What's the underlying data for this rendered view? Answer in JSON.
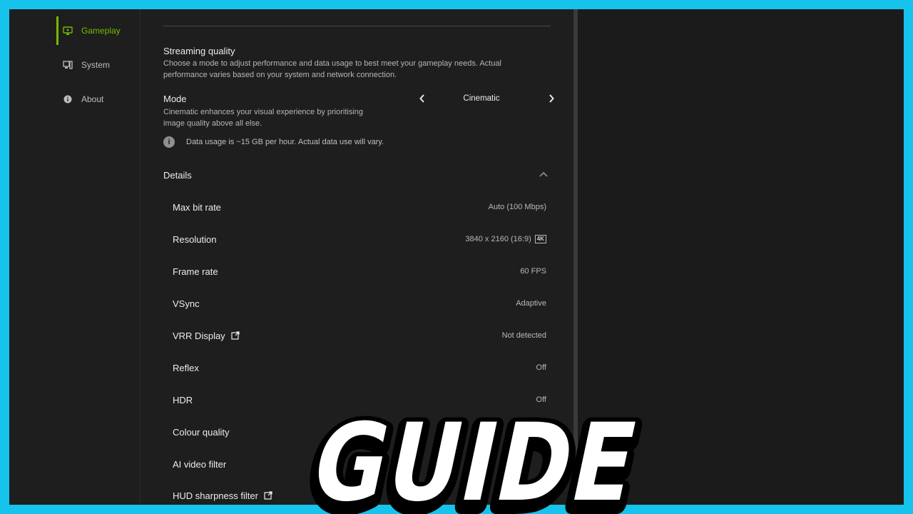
{
  "sidebar": {
    "items": [
      {
        "label": "Gameplay",
        "icon": "monitor-gamepad-icon",
        "active": true
      },
      {
        "label": "System",
        "icon": "system-devices-icon",
        "active": false
      },
      {
        "label": "About",
        "icon": "info-icon",
        "active": false
      }
    ]
  },
  "streaming": {
    "title": "Streaming quality",
    "description_line1": "Choose a mode to adjust performance and data usage to best meet your gameplay needs. Actual",
    "description_line2": "performance varies based on your system and network connection."
  },
  "mode": {
    "title": "Mode",
    "description_line1": "Cinematic enhances your visual experience by prioritising",
    "description_line2": "image quality above all else.",
    "value": "Cinematic",
    "info": "Data usage is ~15 GB per hour. Actual data use will vary."
  },
  "details": {
    "title": "Details",
    "rows": [
      {
        "label": "Max bit rate",
        "value": "Auto (100 Mbps)"
      },
      {
        "label": "Resolution",
        "value": "3840 x 2160 (16:9)",
        "badge": "4K"
      },
      {
        "label": "Frame rate",
        "value": "60 FPS"
      },
      {
        "label": "VSync",
        "value": "Adaptive"
      },
      {
        "label": "VRR Display",
        "value": "Not detected",
        "external_link": true
      },
      {
        "label": "Reflex",
        "value": "Off"
      },
      {
        "label": "HDR",
        "value": "Off"
      },
      {
        "label": "Colour quality",
        "value": ""
      },
      {
        "label": "AI video filter",
        "value": ""
      },
      {
        "label": "HUD sharpness filter",
        "value": "",
        "external_link": true
      }
    ]
  },
  "overlay": {
    "text": "GUIDE"
  },
  "colors": {
    "accent": "#76b900",
    "border": "#16c3ec",
    "background": "#1e1e1e"
  }
}
